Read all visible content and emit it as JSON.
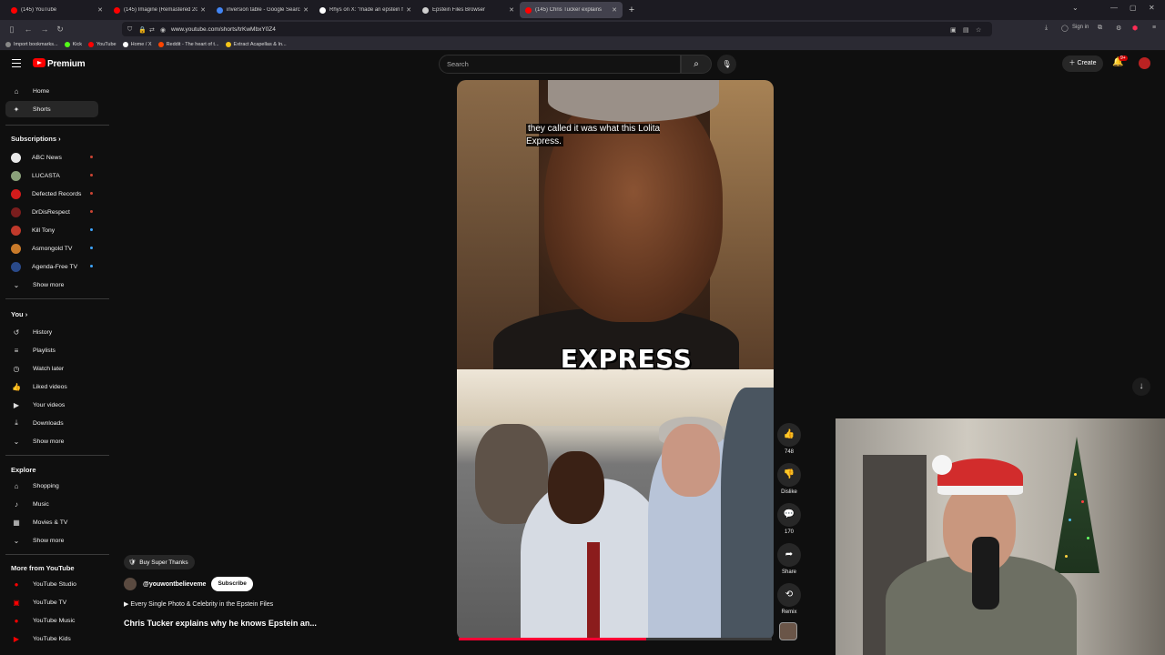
{
  "browser": {
    "tabs": [
      {
        "label": "(145) YouTube",
        "color": "#ff0000"
      },
      {
        "label": "(145) Imagine (Remastered 2010)",
        "color": "#ff0000"
      },
      {
        "label": "inversion table - Google Search",
        "color": "#4285f4"
      },
      {
        "label": "Rhys on X: \"made an epstein file",
        "color": "#ffffff"
      },
      {
        "label": "Epstein Files Browser",
        "color": "#cfcfcf"
      },
      {
        "label": "(145) Chris Tucker explains",
        "color": "#ff0000"
      }
    ],
    "new_tab": "+",
    "url": "www.youtube.com/shorts/trKwMbxY0Z4",
    "sign_in": "Sign in",
    "bookmarks": [
      {
        "label": "Import bookmarks...",
        "color": "#888888"
      },
      {
        "label": "Kick",
        "color": "#53fc18"
      },
      {
        "label": "YouTube",
        "color": "#ff0000"
      },
      {
        "label": "Home / X",
        "color": "#ffffff"
      },
      {
        "label": "Reddit - The heart of t...",
        "color": "#ff4500"
      },
      {
        "label": "Extract Acapellas & In...",
        "color": "#f5c518"
      }
    ]
  },
  "header": {
    "brand": "Premium",
    "search_placeholder": "Search",
    "create_label": "Create",
    "notif_count": "9+"
  },
  "sidebar": {
    "main": [
      {
        "label": "Home",
        "icon": "home-icon",
        "glyph": "⌂"
      },
      {
        "label": "Shorts",
        "icon": "shorts-icon",
        "glyph": "✦"
      }
    ],
    "subscriptions_title": "Subscriptions",
    "subscriptions": [
      {
        "label": "ABC News",
        "color": "#e9e9e9"
      },
      {
        "label": "LUCASTA",
        "color": "#8aa17a"
      },
      {
        "label": "Defected Records",
        "color": "#d31b1b"
      },
      {
        "label": "DrDisRespect",
        "color": "#7a1d1d"
      },
      {
        "label": "Kill Tony",
        "color": "#c0392b"
      },
      {
        "label": "Asmongold TV",
        "color": "#c97a2a"
      },
      {
        "label": "Agenda-Free TV",
        "color": "#2a4a8a"
      }
    ],
    "show_more": "Show more",
    "you_title": "You",
    "you_items": [
      {
        "label": "History",
        "icon": "history-icon",
        "glyph": "↺"
      },
      {
        "label": "Playlists",
        "icon": "playlists-icon",
        "glyph": "≡"
      },
      {
        "label": "Watch later",
        "icon": "watch-later-icon",
        "glyph": "◷"
      },
      {
        "label": "Liked videos",
        "icon": "liked-videos-icon",
        "glyph": "👍"
      },
      {
        "label": "Your videos",
        "icon": "your-videos-icon",
        "glyph": "▶"
      },
      {
        "label": "Downloads",
        "icon": "downloads-icon",
        "glyph": "⤓"
      }
    ],
    "explore_title": "Explore",
    "explore_items": [
      {
        "label": "Shopping",
        "icon": "shopping-icon",
        "glyph": "⌂"
      },
      {
        "label": "Music",
        "icon": "music-icon",
        "glyph": "♪"
      },
      {
        "label": "Movies & TV",
        "icon": "movies-icon",
        "glyph": "▦"
      }
    ],
    "more_title": "More from YouTube",
    "more_items": [
      {
        "label": "YouTube Studio",
        "color": "#ff0000"
      },
      {
        "label": "YouTube TV",
        "color": "#ff0000"
      },
      {
        "label": "YouTube Music",
        "color": "#ff0000"
      },
      {
        "label": "YouTube Kids",
        "color": "#ff0000"
      }
    ]
  },
  "video": {
    "caption": "they called it was what this Lolita Express.",
    "overlay_word": "EXPRESS",
    "progress": 0.6
  },
  "actions": [
    {
      "name": "like",
      "glyph": "👍",
      "label": "748"
    },
    {
      "name": "dislike",
      "glyph": "👎",
      "label": "Dislike"
    },
    {
      "name": "comments",
      "glyph": "💬",
      "label": "170"
    },
    {
      "name": "share",
      "glyph": "➦",
      "label": "Share"
    },
    {
      "name": "remix",
      "glyph": "⟲",
      "label": "Remix"
    }
  ],
  "meta": {
    "super_thanks": "Buy Super Thanks",
    "channel": "@youwontbelieveme",
    "subscribe": "Subscribe",
    "playlist": "Every Single Photo & Celebrity in the Epstein Files",
    "title": "Chris Tucker explains why he knows Epstein an..."
  }
}
